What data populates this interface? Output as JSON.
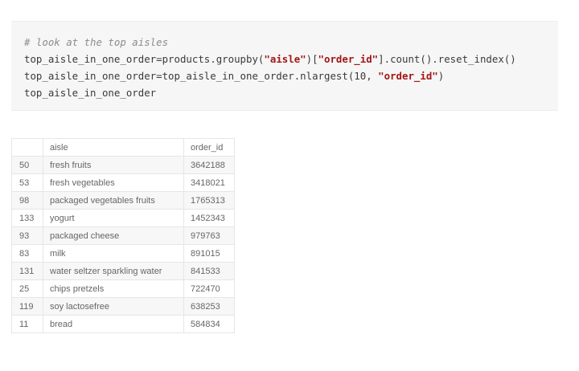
{
  "code_cell": {
    "lines": [
      "# look at the top aisles",
      "top_aisle_in_one_order=products.groupby(\"aisle\")[\"order_id\"].count().reset_index()",
      "top_aisle_in_one_order=top_aisle_in_one_order.nlargest(10, \"order_id\")",
      "top_aisle_in_one_order"
    ],
    "l1_pre": "top_aisle_in_one_order=products.groupby(",
    "l1_s1": "\"aisle\"",
    "l1_mid": ")[",
    "l1_s2": "\"order_id\"",
    "l1_post": "].count().reset_index()",
    "l2_pre": "top_aisle_in_one_order=top_aisle_in_one_order.nlargest(10, ",
    "l2_s1": "\"order_id\"",
    "l2_post": ")"
  },
  "table": {
    "columns": [
      "",
      "aisle",
      "order_id"
    ],
    "rows": [
      {
        "index": "50",
        "aisle": "fresh fruits",
        "order_id": "3642188"
      },
      {
        "index": "53",
        "aisle": "fresh vegetables",
        "order_id": "3418021"
      },
      {
        "index": "98",
        "aisle": "packaged vegetables fruits",
        "order_id": "1765313"
      },
      {
        "index": "133",
        "aisle": "yogurt",
        "order_id": "1452343"
      },
      {
        "index": "93",
        "aisle": "packaged cheese",
        "order_id": "979763"
      },
      {
        "index": "83",
        "aisle": "milk",
        "order_id": "891015"
      },
      {
        "index": "131",
        "aisle": "water seltzer sparkling water",
        "order_id": "841533"
      },
      {
        "index": "25",
        "aisle": "chips pretzels",
        "order_id": "722470"
      },
      {
        "index": "119",
        "aisle": "soy lactosefree",
        "order_id": "638253"
      },
      {
        "index": "11",
        "aisle": "bread",
        "order_id": "584834"
      }
    ]
  }
}
